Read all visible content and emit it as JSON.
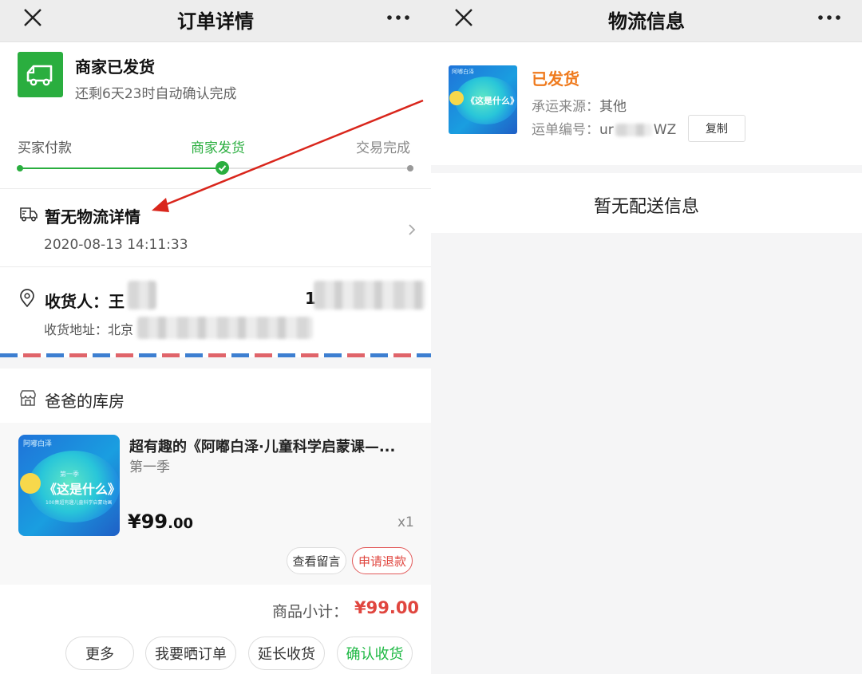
{
  "left_screen": {
    "title": "订单详情",
    "status": {
      "title": "商家已发货",
      "subtitle": "还剩6天23时自动确认完成"
    },
    "steps": [
      "买家付款",
      "商家发货",
      "交易完成"
    ],
    "logistics": {
      "title": "暂无物流详情",
      "time": "2020-08-13 14:11:33"
    },
    "receiver": {
      "label": "收货人：王",
      "phone_prefix": "1",
      "address_label": "收货地址：北京"
    },
    "shop_name": "爸爸的库房",
    "goods": {
      "title": "超有趣的《阿嘟白泽·儿童科学启蒙课—...",
      "subtitle": "第一季",
      "price_int": "¥99",
      "price_dec": ".00",
      "qty": "x1",
      "thumb_brand": "阿嘟白泽",
      "thumb_season": "第一季",
      "thumb_title": "《这是什么》",
      "thumb_tag": "100集超有趣儿童科学启蒙动画"
    },
    "item_buttons": {
      "view_message": "查看留言",
      "refund": "申请退款"
    },
    "subtotal_label": "商品小计：",
    "subtotal_value": "¥99.00",
    "bottom_buttons": {
      "more": "更多",
      "share_order": "我要晒订单",
      "extend": "延长收货",
      "confirm": "确认收货"
    }
  },
  "right_screen": {
    "title": "物流信息",
    "status": "已发货",
    "carrier_label": "承运来源：",
    "carrier_value": "其他",
    "tracking_label": "运单编号：",
    "tracking_prefix": "ur",
    "tracking_suffix": "WZ",
    "copy_button": "复制",
    "empty_text": "暂无配送信息"
  },
  "colors": {
    "accent_green": "#2aae3f",
    "price_red": "#e0463f",
    "status_orange": "#ef7a1d",
    "annotation_arrow": "#d9261c"
  }
}
